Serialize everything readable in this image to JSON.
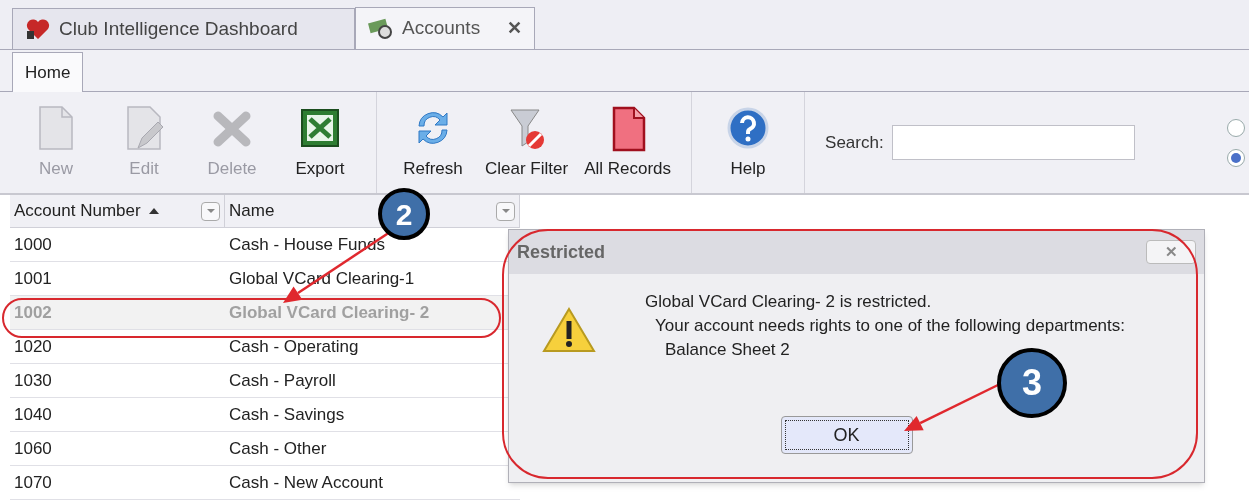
{
  "doc_tabs": [
    {
      "label": "Club Intelligence Dashboard",
      "selected": false,
      "kind": "dashboard"
    },
    {
      "label": "Accounts",
      "selected": true,
      "close_label": "✕",
      "kind": "accounts"
    }
  ],
  "ribbon_tabs": [
    {
      "label": "Home",
      "selected": true
    }
  ],
  "toolbar_groups": [
    [
      {
        "label": "New",
        "kind": "new",
        "disabled": true
      },
      {
        "label": "Edit",
        "kind": "edit",
        "disabled": true
      },
      {
        "label": "Delete",
        "kind": "delete",
        "disabled": true
      },
      {
        "label": "Export",
        "kind": "export",
        "disabled": false
      }
    ],
    [
      {
        "label": "Refresh",
        "kind": "refresh",
        "disabled": false
      },
      {
        "label": "Clear Filter",
        "kind": "clear_filter",
        "disabled": false
      },
      {
        "label": "All Records",
        "kind": "all_records",
        "disabled": false
      }
    ],
    [
      {
        "label": "Help",
        "kind": "help",
        "disabled": false
      }
    ]
  ],
  "search": {
    "label": "Search:"
  },
  "search_mode": [
    {
      "selected": false
    },
    {
      "selected": true
    }
  ],
  "grid": {
    "columns": [
      {
        "label": "Account Number",
        "sorted_ascending": true
      },
      {
        "label": "Name",
        "sorted_ascending": false
      }
    ],
    "rows": [
      {
        "number": "1000",
        "name": "Cash - House Funds",
        "restricted": false
      },
      {
        "number": "1001",
        "name": "Global VCard Clearing-1",
        "restricted": false
      },
      {
        "number": "1002",
        "name": "Global VCard Clearing- 2",
        "restricted": true
      },
      {
        "number": "1020",
        "name": "Cash - Operating",
        "restricted": false
      },
      {
        "number": "1030",
        "name": "Cash - Payroll",
        "restricted": false
      },
      {
        "number": "1040",
        "name": "Cash - Savings",
        "restricted": false
      },
      {
        "number": "1060",
        "name": "Cash - Other",
        "restricted": false
      },
      {
        "number": "1070",
        "name": "Cash - New Account",
        "restricted": false
      }
    ]
  },
  "dialog": {
    "title": "Restricted",
    "close_label": "✕",
    "lines": [
      "Global VCard Clearing- 2 is restricted.",
      "Your account needs rights to one of the following departments:",
      "Balance Sheet 2"
    ],
    "ok_label": "OK"
  },
  "callouts": [
    {
      "label": "2"
    },
    {
      "label": "3"
    }
  ]
}
